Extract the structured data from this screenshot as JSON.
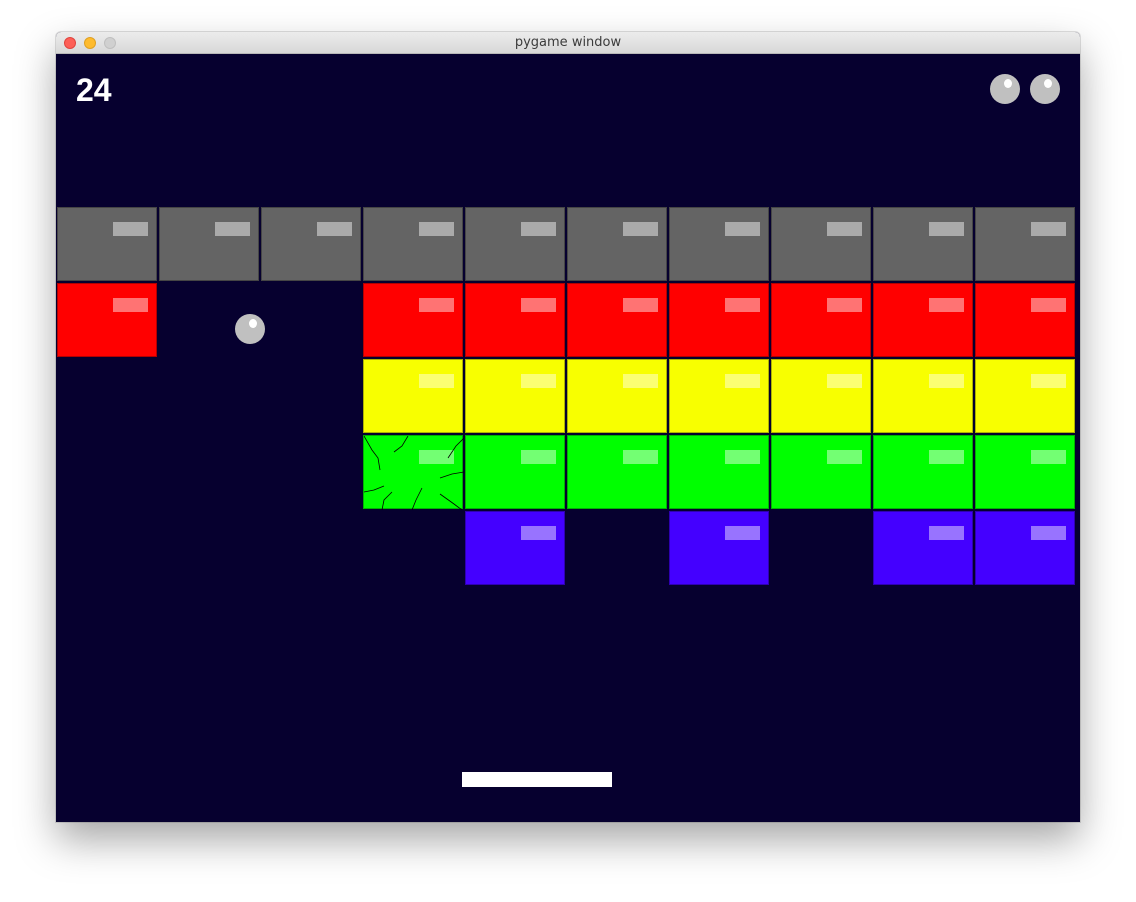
{
  "window": {
    "title": "pygame window"
  },
  "hud": {
    "score": "24",
    "lives_remaining": 2
  },
  "colors": {
    "background": "#06002f",
    "gray": "#646464",
    "red": "#ff0000",
    "yellow": "#f8ff00",
    "green": "#00ff00",
    "blue": "#4400ff",
    "ball": "#c0c0c0",
    "paddle": "#ffffff"
  },
  "bricks": {
    "grid_rows": [
      [
        "gray",
        "gray",
        "gray",
        "gray",
        "gray",
        "gray",
        "gray",
        "gray",
        "gray",
        "gray"
      ],
      [
        "red",
        null,
        null,
        "red",
        "red",
        "red",
        "red",
        "red",
        "red",
        "red"
      ],
      [
        null,
        null,
        null,
        "yellow",
        "yellow",
        "yellow",
        "yellow",
        "yellow",
        "yellow",
        "yellow"
      ],
      [
        null,
        null,
        null,
        "green-cracked",
        "green",
        "green",
        "green",
        "green",
        "green",
        "green"
      ],
      [
        null,
        null,
        null,
        null,
        "blue",
        null,
        "blue",
        null,
        "blue",
        "blue"
      ]
    ]
  }
}
